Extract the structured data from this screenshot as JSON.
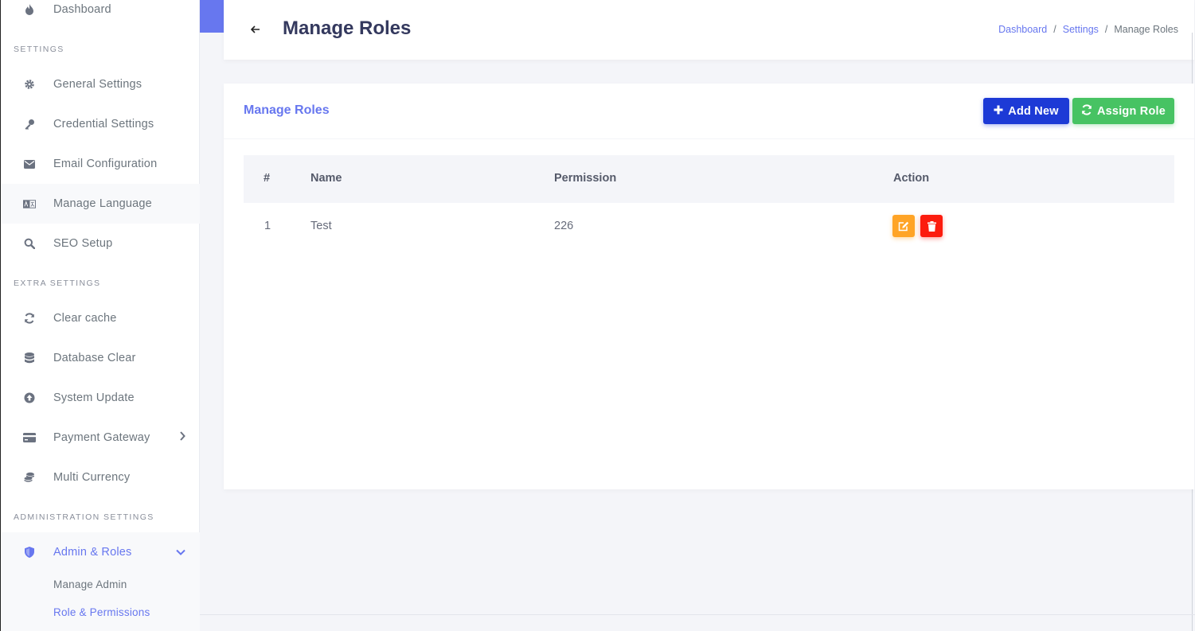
{
  "sidebar": {
    "top_item": {
      "label": "Dashboard",
      "icon": "fire-icon"
    },
    "sections": {
      "settings": "Settings",
      "extra": "Extra Settings",
      "admin": "Administration Settings"
    },
    "settings_items": [
      {
        "label": "General Settings",
        "icon": "gear-icon"
      },
      {
        "label": "Credential Settings",
        "icon": "key-icon"
      },
      {
        "label": "Email Configuration",
        "icon": "envelope-icon"
      },
      {
        "label": "Manage Language",
        "icon": "language-icon"
      },
      {
        "label": "SEO Setup",
        "icon": "search-icon"
      }
    ],
    "extra_items": [
      {
        "label": "Clear cache",
        "icon": "refresh-icon"
      },
      {
        "label": "Database Clear",
        "icon": "database-icon"
      },
      {
        "label": "System Update",
        "icon": "upload-circle-icon"
      },
      {
        "label": "Payment Gateway",
        "icon": "credit-card-icon"
      },
      {
        "label": "Multi Currency",
        "icon": "coins-icon"
      }
    ],
    "admin_item": {
      "label": "Admin & Roles",
      "icon": "shield-icon"
    },
    "admin_subitems": [
      {
        "label": "Manage Admin"
      },
      {
        "label": "Role & Permissions"
      }
    ]
  },
  "header": {
    "title": "Manage Roles",
    "breadcrumb": [
      "Dashboard",
      "Settings",
      "Manage Roles"
    ],
    "separator": "/"
  },
  "card": {
    "title": "Manage Roles",
    "add_button": "Add New",
    "assign_button": "Assign Role",
    "columns": [
      "#",
      "Name",
      "Permission",
      "Action"
    ],
    "rows": [
      {
        "index": "1",
        "name": "Test",
        "permission": "226"
      }
    ]
  },
  "colors": {
    "primary": "#6777ef",
    "add_button": "#1d3ad6",
    "assign_button": "#47c363",
    "edit_button": "#ffa426",
    "delete_button": "#fc1c0e"
  }
}
